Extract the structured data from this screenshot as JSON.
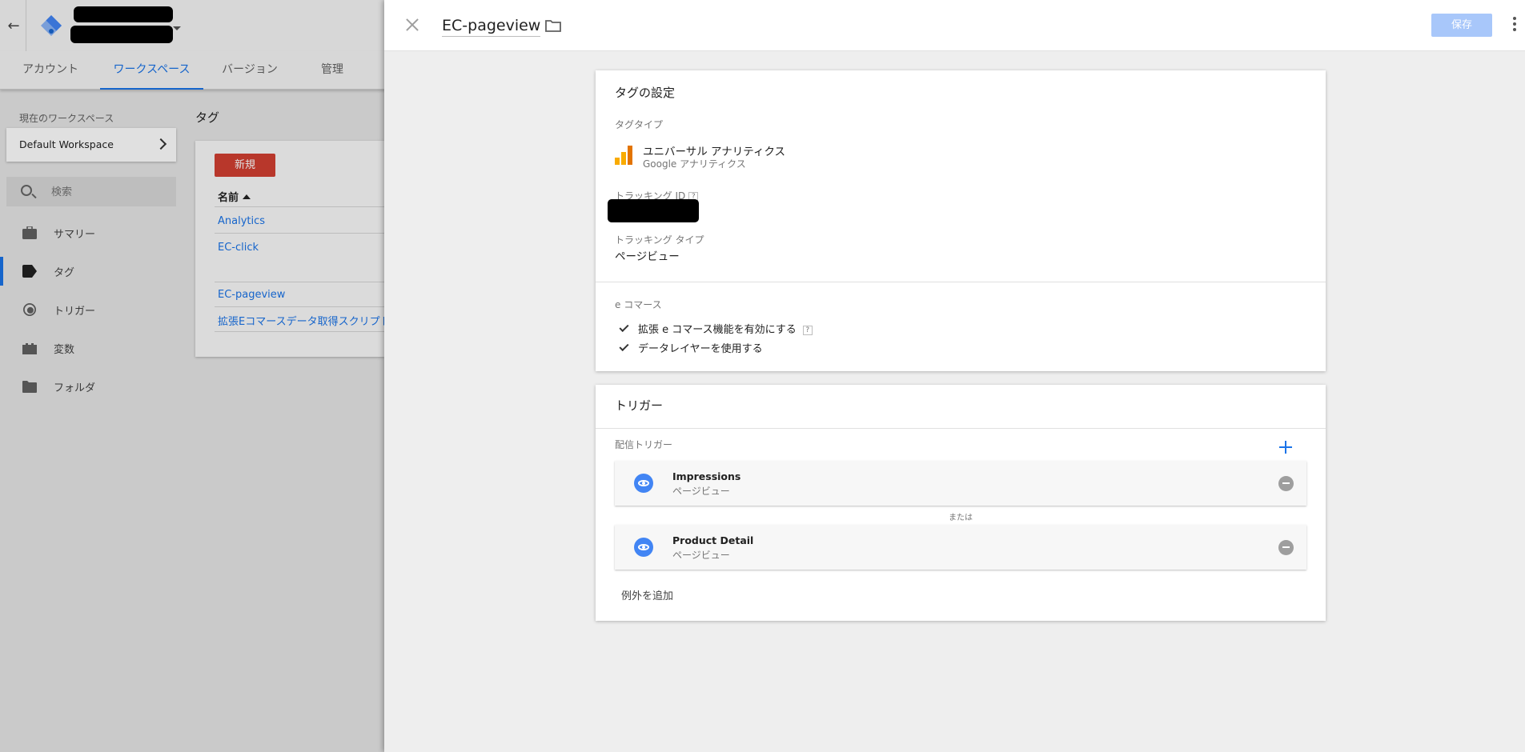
{
  "header": {
    "back_icon": "arrow-back-icon",
    "logo_icon": "gtm-diamond-icon"
  },
  "nav": {
    "tabs": [
      {
        "label": "アカウント"
      },
      {
        "label": "ワークスペース",
        "active": true
      },
      {
        "label": "バージョン"
      },
      {
        "label": "管理"
      }
    ]
  },
  "workspace": {
    "label": "現在のワークスペース",
    "name": "Default Workspace"
  },
  "search": {
    "placeholder": "検索"
  },
  "sidebar": {
    "items": [
      {
        "label": "サマリー",
        "icon": "briefcase-icon"
      },
      {
        "label": "タグ",
        "icon": "tag-icon",
        "active": true
      },
      {
        "label": "トリガー",
        "icon": "trigger-icon"
      },
      {
        "label": "変数",
        "icon": "variables-icon"
      },
      {
        "label": "フォルダ",
        "icon": "folder-icon"
      }
    ]
  },
  "tags_list": {
    "heading": "タグ",
    "new_button": "新規",
    "column_name": "名前",
    "rows": [
      {
        "name": "Analytics"
      },
      {
        "name": "EC-click"
      },
      {
        "name": "EC-pageview"
      },
      {
        "name": "拡張Eコマースデータ取得スクリプト"
      }
    ]
  },
  "editor": {
    "title": "EC-pageview",
    "save_label": "保存",
    "colors": {
      "accent": "#1a73e8",
      "save_disabled": "#a8c7fa",
      "new_button": "#d23f31"
    },
    "tag_config": {
      "title": "タグの設定",
      "tag_type_label": "タグタイプ",
      "tag_type_name": "ユニバーサル アナリティクス",
      "tag_type_vendor": "Google アナリティクス",
      "tracking_id_label": "トラッキング ID",
      "help_glyph": "?",
      "tracking_type_label": "トラッキング タイプ",
      "tracking_type_value": "ページビュー",
      "ecommerce_label": "e コマース",
      "ecommerce_options": [
        {
          "label": "拡張 e コマース機能を有効にする",
          "checked": true
        },
        {
          "label": "データレイヤーを使用する",
          "checked": true
        }
      ]
    },
    "triggering": {
      "title": "トリガー",
      "firing_label": "配信トリガー",
      "triggers": [
        {
          "name": "Impressions",
          "type": "ページビュー"
        },
        {
          "name": "Product Detail",
          "type": "ページビュー"
        }
      ],
      "or_text": "または",
      "add_exception": "例外を追加"
    }
  }
}
